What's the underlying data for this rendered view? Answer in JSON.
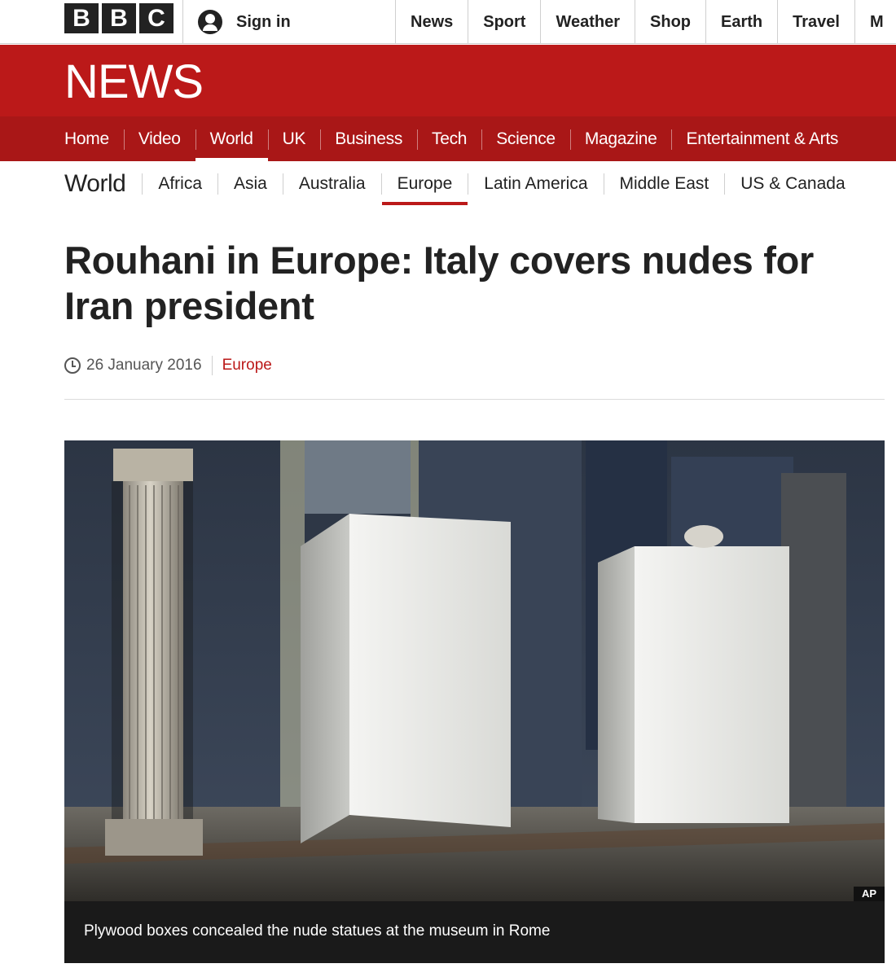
{
  "brand": {
    "letters": [
      "B",
      "B",
      "C"
    ]
  },
  "account": {
    "signin_label": "Sign in"
  },
  "global_nav": [
    "News",
    "Sport",
    "Weather",
    "Shop",
    "Earth",
    "Travel",
    "M"
  ],
  "banner": {
    "title": "NEWS"
  },
  "primary_nav": {
    "items": [
      "Home",
      "Video",
      "World",
      "UK",
      "Business",
      "Tech",
      "Science",
      "Magazine",
      "Entertainment & Arts"
    ],
    "active": "World"
  },
  "secondary_nav": {
    "title": "World",
    "items": [
      "Africa",
      "Asia",
      "Australia",
      "Europe",
      "Latin America",
      "Middle East",
      "US & Canada"
    ],
    "active": "Europe"
  },
  "article": {
    "headline": "Rouhani in Europe: Italy covers nudes for Iran president",
    "date": "26 January 2016",
    "section": "Europe"
  },
  "figure": {
    "credit": "AP",
    "caption": "Plywood boxes concealed the nude statues at the museum in Rome"
  },
  "colors": {
    "brand_red": "#bb1919",
    "nav_red": "#a91717",
    "text": "#222222"
  }
}
